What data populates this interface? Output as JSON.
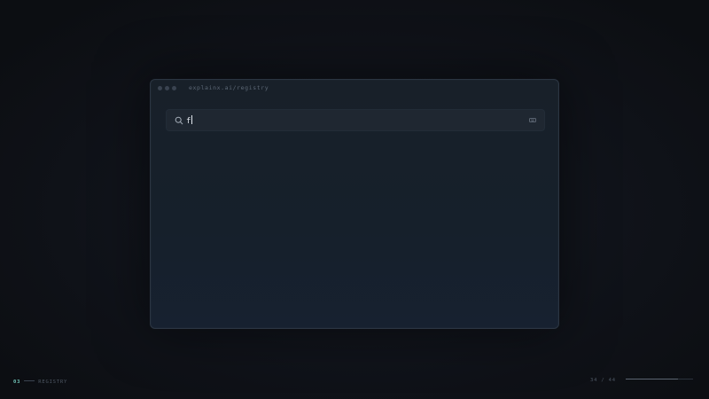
{
  "window": {
    "url": "explainx.ai/registry"
  },
  "search": {
    "value": "f",
    "icon": "search-icon",
    "trailing_icon": "keyboard-icon"
  },
  "footer": {
    "section_number": "03",
    "section_label": "REGISTRY",
    "page_current": "34",
    "page_separator": "/",
    "page_total": "44",
    "progress_fraction": 0.773
  },
  "colors": {
    "accent": "#6ec1b5",
    "background": "#0d0f13",
    "window": "#182029",
    "search_box": "#1f2731"
  }
}
